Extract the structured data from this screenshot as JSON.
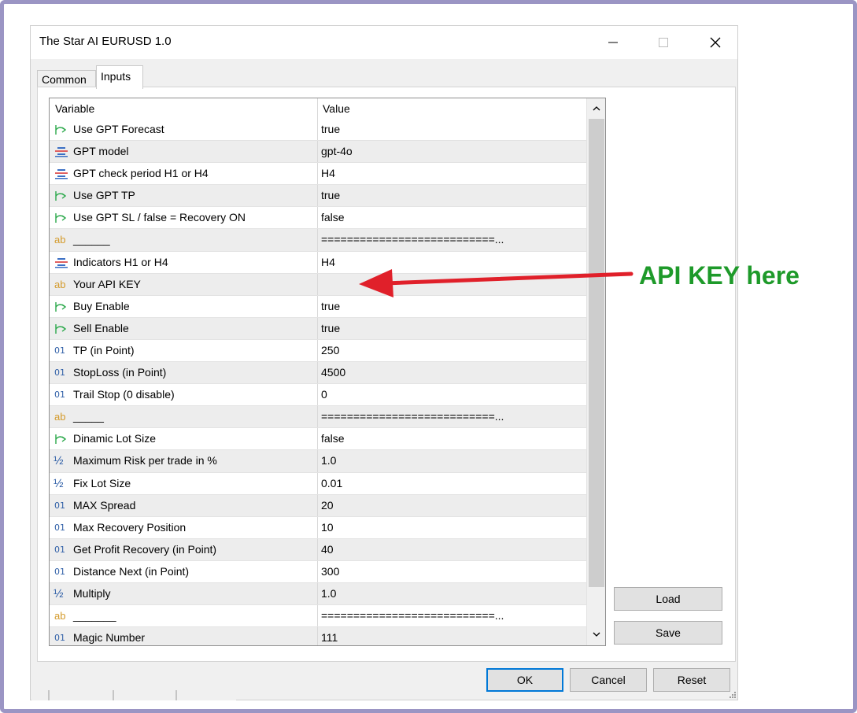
{
  "window": {
    "title": "The Star AI EURUSD 1.0"
  },
  "tabs": [
    {
      "label": "Common",
      "active": false
    },
    {
      "label": "Inputs",
      "active": true
    }
  ],
  "grid": {
    "headers": {
      "variable": "Variable",
      "value": "Value"
    },
    "rows": [
      {
        "icon": "bool-icon",
        "variable": "Use GPT Forecast",
        "value": "true"
      },
      {
        "icon": "enum-icon",
        "variable": "GPT model",
        "value": "gpt-4o"
      },
      {
        "icon": "enum-icon",
        "variable": "GPT check period H1 or H4",
        "value": "H4"
      },
      {
        "icon": "bool-icon",
        "variable": "Use GPT TP",
        "value": "true"
      },
      {
        "icon": "bool-icon",
        "variable": "Use GPT SL / false = Recovery ON",
        "value": "false"
      },
      {
        "icon": "string-icon",
        "variable": "______",
        "value": "===========================..."
      },
      {
        "icon": "enum-icon",
        "variable": "Indicators H1 or H4",
        "value": "H4"
      },
      {
        "icon": "string-icon",
        "variable": "Your API KEY",
        "value": ""
      },
      {
        "icon": "bool-icon",
        "variable": "Buy Enable",
        "value": "true"
      },
      {
        "icon": "bool-icon",
        "variable": "Sell Enable",
        "value": "true"
      },
      {
        "icon": "int-icon",
        "variable": "TP (in Point)",
        "value": "250"
      },
      {
        "icon": "int-icon",
        "variable": "StopLoss (in Point)",
        "value": "4500"
      },
      {
        "icon": "int-icon",
        "variable": "Trail Stop (0 disable)",
        "value": "0"
      },
      {
        "icon": "string-icon",
        "variable": "_____",
        "value": "===========================..."
      },
      {
        "icon": "bool-icon",
        "variable": "Dinamic Lot Size",
        "value": "false"
      },
      {
        "icon": "double-icon",
        "variable": "Maximum Risk per trade in %",
        "value": "1.0"
      },
      {
        "icon": "double-icon",
        "variable": "Fix Lot Size",
        "value": "0.01"
      },
      {
        "icon": "int-icon",
        "variable": "MAX Spread",
        "value": "20"
      },
      {
        "icon": "int-icon",
        "variable": "Max Recovery Position",
        "value": "10"
      },
      {
        "icon": "int-icon",
        "variable": "Get Profit Recovery (in Point)",
        "value": "40"
      },
      {
        "icon": "int-icon",
        "variable": "Distance Next (in Point)",
        "value": "300"
      },
      {
        "icon": "double-icon",
        "variable": "Multiply",
        "value": "1.0"
      },
      {
        "icon": "string-icon",
        "variable": "_______",
        "value": "===========================..."
      },
      {
        "icon": "int-icon",
        "variable": "Magic Number",
        "value": "111"
      }
    ]
  },
  "icon_glyphs": {
    "string": "ab",
    "int": "01",
    "double": "½"
  },
  "side_buttons": {
    "load": "Load",
    "save": "Save"
  },
  "footer_buttons": {
    "ok": "OK",
    "cancel": "Cancel",
    "reset": "Reset"
  },
  "annotation": {
    "text": "API KEY here",
    "color": "#1e9a2a",
    "arrow_color": "#e0202a"
  },
  "colors": {
    "frame": "#9b95c4",
    "ok_border": "#0078d7",
    "bool_icon": "#2aa84a",
    "enum_icon": "#3b6fc4"
  }
}
